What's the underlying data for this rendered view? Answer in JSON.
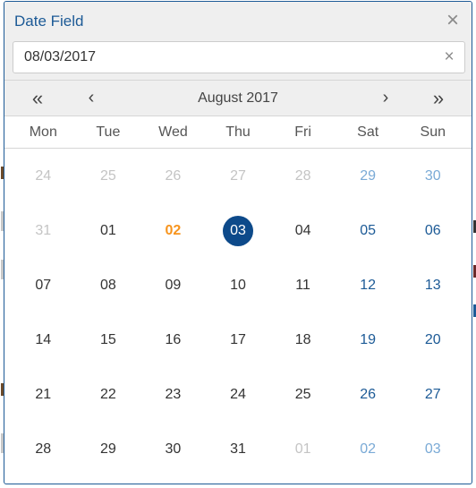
{
  "dialog": {
    "title": "Date Field",
    "close_icon": "close-icon",
    "input_value": "08/03/2017",
    "clear_icon": "clear-icon"
  },
  "navigation": {
    "prev_year": "«",
    "prev_month": "‹",
    "month_label": "August 2017",
    "next_month": "›",
    "next_year": "»"
  },
  "weekdays": [
    "Mon",
    "Tue",
    "Wed",
    "Thu",
    "Fri",
    "Sat",
    "Sun"
  ],
  "weeks": [
    [
      {
        "label": "24",
        "state": "other"
      },
      {
        "label": "25",
        "state": "other"
      },
      {
        "label": "26",
        "state": "other"
      },
      {
        "label": "27",
        "state": "other"
      },
      {
        "label": "28",
        "state": "other"
      },
      {
        "label": "29",
        "state": "other-weekend"
      },
      {
        "label": "30",
        "state": "other-weekend"
      }
    ],
    [
      {
        "label": "31",
        "state": "other"
      },
      {
        "label": "01",
        "state": "normal"
      },
      {
        "label": "02",
        "state": "today"
      },
      {
        "label": "03",
        "state": "selected"
      },
      {
        "label": "04",
        "state": "normal"
      },
      {
        "label": "05",
        "state": "weekend"
      },
      {
        "label": "06",
        "state": "weekend"
      }
    ],
    [
      {
        "label": "07",
        "state": "normal"
      },
      {
        "label": "08",
        "state": "normal"
      },
      {
        "label": "09",
        "state": "normal"
      },
      {
        "label": "10",
        "state": "normal"
      },
      {
        "label": "11",
        "state": "normal"
      },
      {
        "label": "12",
        "state": "weekend"
      },
      {
        "label": "13",
        "state": "weekend"
      }
    ],
    [
      {
        "label": "14",
        "state": "normal"
      },
      {
        "label": "15",
        "state": "normal"
      },
      {
        "label": "16",
        "state": "normal"
      },
      {
        "label": "17",
        "state": "normal"
      },
      {
        "label": "18",
        "state": "normal"
      },
      {
        "label": "19",
        "state": "weekend"
      },
      {
        "label": "20",
        "state": "weekend"
      }
    ],
    [
      {
        "label": "21",
        "state": "normal"
      },
      {
        "label": "22",
        "state": "normal"
      },
      {
        "label": "23",
        "state": "normal"
      },
      {
        "label": "24",
        "state": "normal"
      },
      {
        "label": "25",
        "state": "normal"
      },
      {
        "label": "26",
        "state": "weekend"
      },
      {
        "label": "27",
        "state": "weekend"
      }
    ],
    [
      {
        "label": "28",
        "state": "normal"
      },
      {
        "label": "29",
        "state": "normal"
      },
      {
        "label": "30",
        "state": "normal"
      },
      {
        "label": "31",
        "state": "normal"
      },
      {
        "label": "01",
        "state": "other"
      },
      {
        "label": "02",
        "state": "other-weekend"
      },
      {
        "label": "03",
        "state": "other-weekend"
      }
    ]
  ],
  "colors": {
    "accent": "#1c5a96",
    "selected_bg": "#0d4a8a",
    "today": "#f7941d",
    "other_month": "#c4c4c4",
    "other_month_weekend": "#7aaad6",
    "header_bg": "#efefef"
  }
}
